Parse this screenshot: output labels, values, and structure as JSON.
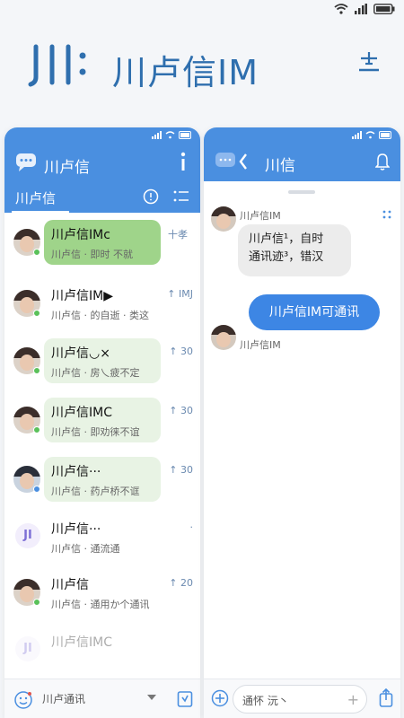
{
  "app": {
    "title": "川卢信IM"
  },
  "left": {
    "title": "川卢信",
    "tab": "川卢信",
    "conversations": [
      {
        "name": "川卢信IMc",
        "message": "川卢信 · 即时 不就",
        "meta": "十孝"
      },
      {
        "name": "川卢信IM▶",
        "message": "川卢信 · 的自逝 · 类这",
        "meta": "↑ IMJ"
      },
      {
        "name": "川卢信◡×",
        "message": "川卢信 · 房乀疲不定",
        "meta": "↑ 30"
      },
      {
        "name": "川卢信IMC",
        "message": "川卢信 · 即劝徕不谊",
        "meta": "↑ 30"
      },
      {
        "name": "川卢信···",
        "message": "川卢信 · 药卢桥不诓",
        "meta": "↑ 30"
      },
      {
        "name": "川卢信···",
        "message": "川卢信 · 通流通",
        "meta": "·"
      },
      {
        "name": "川卢信",
        "message": "川卢信 · 通用か个通讯",
        "meta": "↑ 20"
      },
      {
        "name": "川卢信IMC",
        "message": "",
        "meta": ""
      }
    ],
    "input_text": "川卢通讯"
  },
  "right": {
    "title": "川信",
    "sender_name": "川卢信IM",
    "incoming_line1": "川卢信¹，自时",
    "incoming_line2": "通讯迹³，错汉",
    "outgoing": "川卢信IM可通讯",
    "sender_name2": "川卢信IM",
    "input_placeholder": "通怀 沅丶",
    "plus_label": "+"
  },
  "colors": {
    "accent": "#4a8fe0",
    "outgoing_bubble": "#3d86e4",
    "highlight_bubble": "#9fd48a"
  }
}
